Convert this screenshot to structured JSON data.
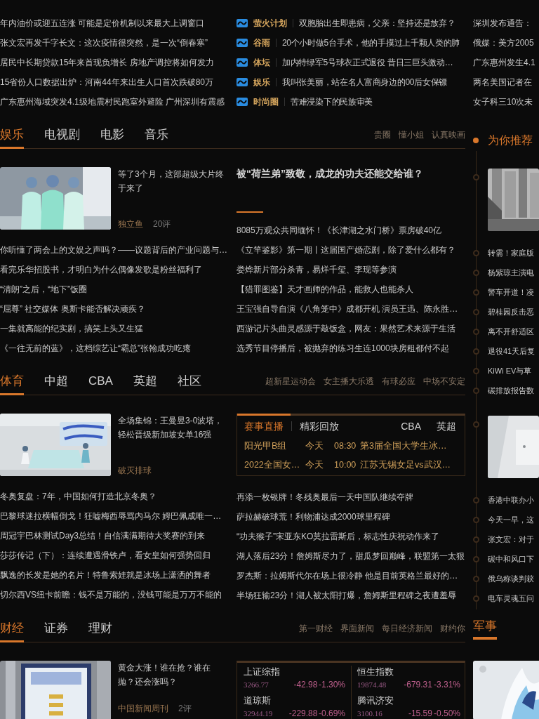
{
  "top_headlines": [
    "年内油价或迎五连涨 可能是定价机制以来最大上调窗口",
    "张文宏再发千字长文：这次疫情很突然，是一次“倒春寒”",
    "居民中长期贷款15年来首现负增长 房地产调控将如何发力",
    "15省份人口数据出炉：河南44年来出生人口首次跌破80万",
    "广东惠州海域突发4.1级地震村民跑室外避险 广州深圳有震感"
  ],
  "channel_headlines": [
    {
      "tag": "萤火计划",
      "title": "双胞胎出生即患病，父亲：坚持还是放弃？"
    },
    {
      "tag": "谷雨",
      "title": "20个小时做5台手术，他的手摸过上千颗人类的肺"
    },
    {
      "tag": "体坛",
      "title": "加内特绿军5号球衣正式退役 昔日三巨头激动…"
    },
    {
      "tag": "娱乐",
      "title": "我叫张美丽，站在名人富商身边的00后女保镖"
    },
    {
      "tag": "时尚圈",
      "title": "苦难浸染下的民族审美"
    }
  ],
  "side_headlines": [
    "深圳发布通告：",
    "俄媒：美方2005",
    "广东惠州发生4.1",
    "两名美国记者在",
    "女子科三10次未"
  ],
  "sections": [
    {
      "tabs": [
        {
          "label": "娱乐",
          "selected": true
        },
        {
          "label": "电视剧",
          "selected": false
        },
        {
          "label": "电影",
          "selected": false
        },
        {
          "label": "音乐",
          "selected": false
        }
      ],
      "links": [
        "贵圈",
        "懂小姐",
        "认真映画"
      ],
      "feature": {
        "title": "等了3个月，这部超级大片终于来了",
        "source": "独立鱼",
        "comments": "20评"
      },
      "panel": {
        "kind": "headline",
        "title": "被“荷兰弟”致敬，成龙的功夫还能交给谁？"
      },
      "list": [
        "你听懂了两会上的文娱之声吗？——议题背后的产业问题与…",
        "看完乐华招股书，才明白为什么偶像发歌是粉丝福利了",
        "“清朗”之后，“地下”饭圈",
        "“屈尊” 社交媒体 奥斯卡能否解决顽疾？",
        "一集就高能的纪实剧，搞笑上头又生猛",
        "《一往无前的蓝》，这档综艺让“霸总”张翰成功吃瘪"
      ],
      "panel_list": [
        "8085万观众共同缅怀！《长津湖之水门桥》票房破40亿",
        "《立竿鉴影》第一期丨这届国产婚恋剧，除了爱什么都有？",
        "娄烨新片部分杀青，易烊千玺、李现等参演",
        "【猎罪图鉴】天才画师的作品，能救人也能杀人",
        "王宝强自导自演《八角笼中》成都开机 演员王迅、陈永胜…",
        "西游记片头曲灵感源于敲饭盒，网友：果然艺术来源于生活",
        "选秀节目停播后，被抛弃的练习生连1000块房租都付不起"
      ]
    },
    {
      "tabs": [
        {
          "label": "体育",
          "selected": true
        },
        {
          "label": "中超",
          "selected": false
        },
        {
          "label": "CBA",
          "selected": false
        },
        {
          "label": "英超",
          "selected": false
        },
        {
          "label": "社区",
          "selected": false
        }
      ],
      "links": [
        "超新星运动会",
        "女主播大乐透",
        "有球必应",
        "中场不安定"
      ],
      "feature": {
        "title": "全场集锦：王曼昱3-0波塔，轻松晋级新加坡女单16强",
        "source": "破灭排球"
      },
      "panel": {
        "kind": "live",
        "tabs": [
          {
            "label": "赛事直播",
            "selected": true
          },
          {
            "label": "精彩回放",
            "selected": false
          }
        ],
        "filters": [
          "CBA",
          "英超"
        ],
        "rows": [
          {
            "league": "阳光甲B组",
            "day": "今天",
            "time": "08:30",
            "match": "第3届全国大学生冰…"
          },
          {
            "league": "2022全国女…",
            "day": "今天",
            "time": "10:00",
            "match": "江苏无锡女足vs武汉…"
          }
        ]
      },
      "list": [
        "冬奥复盘：7年，中国如何打造北京冬奥？",
        "巴黎球迷拉横幅倒戈！狂嘘梅西辱骂内马尔 姆巴佩成唯一…",
        "周冠宇巴林测试Day3总结！自信满满期待大奖赛的到来",
        "莎莎传记（下）：连续遭遇滑铁卢，看女皇如何强势回归",
        "飘逸的长发是她的名片！特鲁索娃就是冰场上潇洒的舞者",
        "切尔西VS纽卡前瞻：钱不是万能的，没钱可能是万万不能的"
      ],
      "panel_list": [
        "再添一枚银牌！冬残奥最后一天中国队继续夺牌",
        "萨拉赫破球荒！利物浦达成2000球里程碑",
        "“功夫猴子”宋亚东KO莫拉雷斯后，标志性庆祝动作来了",
        "湖人落后23分！詹姆斯尽力了，甜瓜梦回巅峰，联盟第一太狠",
        "罗杰斯：拉姆斯代尔在场上很冷静 他是目前英格兰最好的…",
        "半场狂输23分！湖人被太阳打爆，詹姆斯里程碑之夜遭羞辱"
      ]
    },
    {
      "tabs": [
        {
          "label": "财经",
          "selected": true
        },
        {
          "label": "证券",
          "selected": false
        },
        {
          "label": "理财",
          "selected": false
        }
      ],
      "links": [
        "第一财经",
        "界面新闻",
        "每日经济新闻",
        "财约你"
      ],
      "feature": {
        "title": "黄金大涨！谁在抢？谁在抛？还会涨吗？",
        "source": "中国新闻周刊",
        "comments": "2评"
      },
      "panel": {
        "kind": "stocks",
        "quotes": [
          {
            "name": "上证综指",
            "value": "3266.77",
            "change": "-42.98",
            "percent": "-1.30%"
          },
          {
            "name": "恒生指数",
            "value": "19874.48",
            "change": "-679.31",
            "percent": "-3.31%"
          },
          {
            "name": "道琼斯",
            "value": "32944.19",
            "change": "-229.88",
            "percent": "-0.69%"
          },
          {
            "name": "腾讯济安",
            "value": "3100.16",
            "change": "-15.59",
            "percent": "-0.50%"
          }
        ]
      }
    }
  ],
  "recommend": {
    "title": "为你推荐",
    "items": [
      {
        "kind": "picture"
      },
      {
        "kind": "link",
        "text": "转需！家庭版"
      },
      {
        "kind": "link",
        "text": "杨紫琼主演电"
      },
      {
        "kind": "link",
        "text": "警车开道！凌"
      },
      {
        "kind": "link",
        "text": "碧桂园反击恶"
      },
      {
        "kind": "link",
        "text": "离不开舒适区"
      },
      {
        "kind": "link",
        "text": "退役41天后复"
      },
      {
        "kind": "link",
        "text": "KiWi EV与草"
      },
      {
        "kind": "link",
        "text": "碳排放报告数"
      },
      {
        "kind": "picture"
      },
      {
        "kind": "link",
        "text": "香港中联办小"
      },
      {
        "kind": "link",
        "text": "今天一早，这"
      },
      {
        "kind": "link",
        "text": "张文宏：对于"
      },
      {
        "kind": "link",
        "text": "碳中和风口下"
      },
      {
        "kind": "link",
        "text": "俄乌称谈判获"
      },
      {
        "kind": "link",
        "text": "电车灵魂五问"
      }
    ]
  },
  "military": {
    "title": "军事"
  }
}
